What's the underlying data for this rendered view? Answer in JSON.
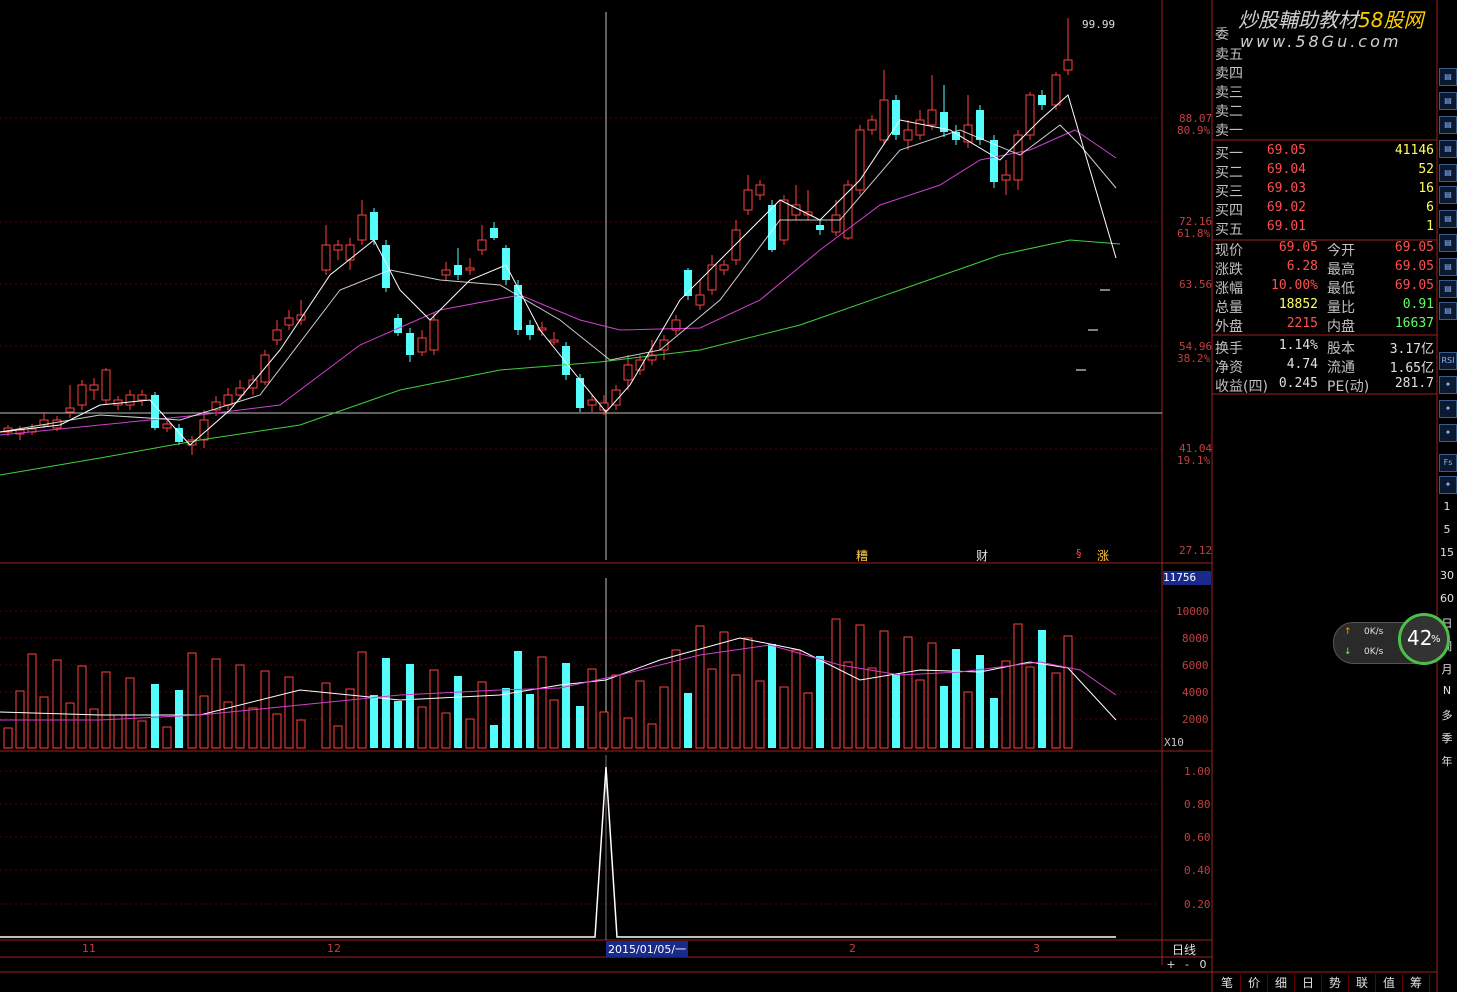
{
  "watermark": {
    "line1": "炒股輔助教材",
    "brand": "58股网",
    "line2": "www.58Gu.com"
  },
  "price_axis": {
    "ticks": [
      "88.07",
      "72.16",
      "63.56",
      "54.96",
      "41.04",
      "27.12"
    ],
    "fib": [
      "80.9%",
      "61.8%",
      "38.2%",
      "19.1%"
    ],
    "high_label": "99.99"
  },
  "volume_axis": {
    "current": "11756",
    "ticks": [
      "10000",
      "8000",
      "6000",
      "4000",
      "2000"
    ],
    "unit": "X10"
  },
  "indicator_axis": {
    "ticks": [
      "1.00",
      "0.80",
      "0.60",
      "0.40",
      "0.20"
    ]
  },
  "date_axis": {
    "labels": [
      "11",
      "12",
      "2",
      "3"
    ],
    "cursor_date": "2015/01/05/一",
    "period": "日线"
  },
  "markers": {
    "m1": "糟",
    "m2": "财",
    "m3": "§",
    "m4": "涨"
  },
  "zoom_controls": {
    "plus": "+",
    "minus": "-",
    "zero": "0"
  },
  "orderbook": {
    "header": "委",
    "sells": [
      "卖五",
      "卖四",
      "卖三",
      "卖二",
      "卖一"
    ],
    "buys": [
      {
        "label": "买一",
        "price": "69.05",
        "vol": "41146"
      },
      {
        "label": "买二",
        "price": "69.04",
        "vol": "52"
      },
      {
        "label": "买三",
        "price": "69.03",
        "vol": "16"
      },
      {
        "label": "买四",
        "price": "69.02",
        "vol": "6"
      },
      {
        "label": "买五",
        "price": "69.01",
        "vol": "1"
      }
    ]
  },
  "stats": [
    {
      "l1": "现价",
      "v1": "69.05",
      "c1": "#ff5050",
      "l2": "今开",
      "v2": "69.05",
      "c2": "#ff5050"
    },
    {
      "l1": "涨跌",
      "v1": "6.28",
      "c1": "#ff5050",
      "l2": "最高",
      "v2": "69.05",
      "c2": "#ff5050"
    },
    {
      "l1": "涨幅",
      "v1": "10.00%",
      "c1": "#ff5050",
      "l2": "最低",
      "v2": "69.05",
      "c2": "#ff5050"
    },
    {
      "l1": "总量",
      "v1": "18852",
      "c1": "#ffff60",
      "l2": "量比",
      "v2": "0.91",
      "c2": "#60ff60"
    },
    {
      "l1": "外盘",
      "v1": "2215",
      "c1": "#ff5050",
      "l2": "内盘",
      "v2": "16637",
      "c2": "#60ff60"
    },
    {
      "l1": "换手",
      "v1": "1.14%",
      "c1": "#e0e0e0",
      "l2": "股本",
      "v2": "3.17亿",
      "c2": "#e0e0e0"
    },
    {
      "l1": "净资",
      "v1": "4.74",
      "c1": "#e0e0e0",
      "l2": "流通",
      "v2": "1.65亿",
      "c2": "#e0e0e0"
    },
    {
      "l1": "收益(四)",
      "v1": "0.245",
      "c1": "#e0e0e0",
      "l2": "PE(动)",
      "v2": "281.7",
      "c2": "#e0e0e0"
    }
  ],
  "speed_widget": {
    "up": "0K/s",
    "down": "0K/s",
    "percent": "42",
    "pct_sign": "%"
  },
  "periods": [
    "1",
    "5",
    "15",
    "30",
    "60",
    "日",
    "周",
    "月",
    "N",
    "多",
    "季",
    "年"
  ],
  "bottom_tabs": [
    "笔",
    "价",
    "细",
    "日",
    "势",
    "联",
    "值",
    "筹"
  ],
  "toolbar": [
    "RSI",
    "Fs",
    "Fio",
    "Fit",
    "fot"
  ],
  "colors": {
    "up": "#ff4040",
    "down": "#54fcfc",
    "ma5": "#ffffff",
    "ma10": "#ffff00",
    "ma20": "#ff40ff",
    "ma60": "#40ff40",
    "grid": "#8b0000"
  }
}
